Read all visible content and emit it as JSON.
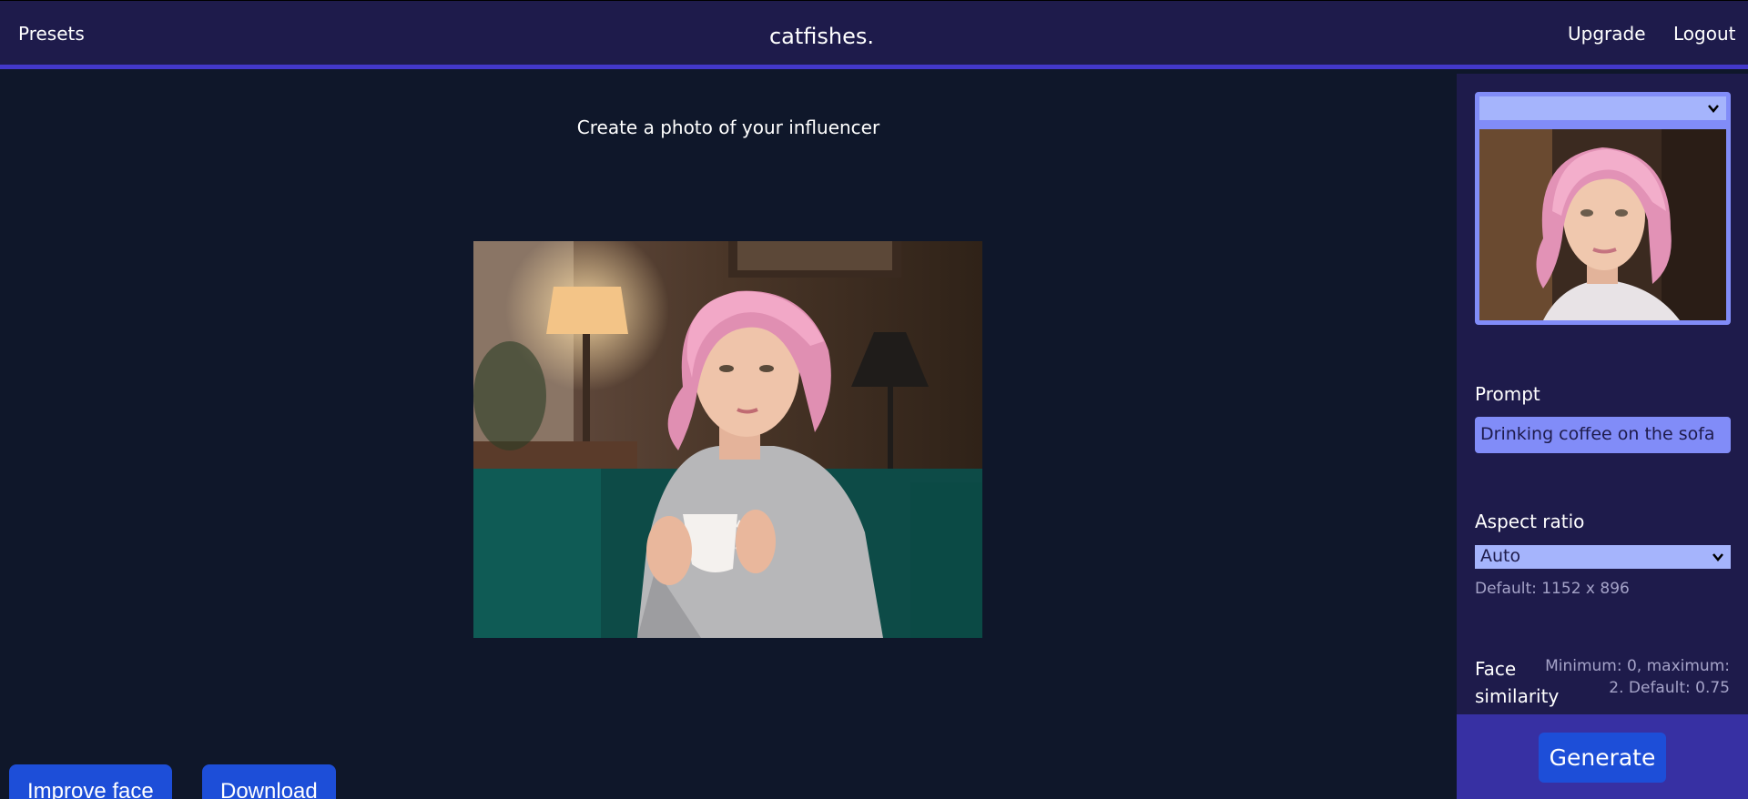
{
  "nav": {
    "presets": "Presets",
    "brand": "catfishes.",
    "upgrade": "Upgrade",
    "logout": "Logout"
  },
  "main": {
    "title": "Create a photo of your influencer",
    "improve_face": "Improve face",
    "download": "Download"
  },
  "sidebar": {
    "preset_selected": "",
    "prompt_label": "Prompt",
    "prompt_value": "Drinking coffee on the sofa",
    "aspect_label": "Aspect ratio",
    "aspect_value": "Auto",
    "aspect_hint": "Default: 1152 x 896",
    "face_label_1": "Face",
    "face_label_2": "similarity",
    "face_hint_1": "Minimum: 0, maximum:",
    "face_hint_2": "2. Default: 0.75",
    "generate": "Generate"
  },
  "colors": {
    "background": "#0f172a",
    "nav": "#1e1b4b",
    "accent": "#4338ca",
    "input": "#818cf8",
    "button": "#1d4ed8"
  },
  "icons": [
    "chevron-down-icon"
  ]
}
